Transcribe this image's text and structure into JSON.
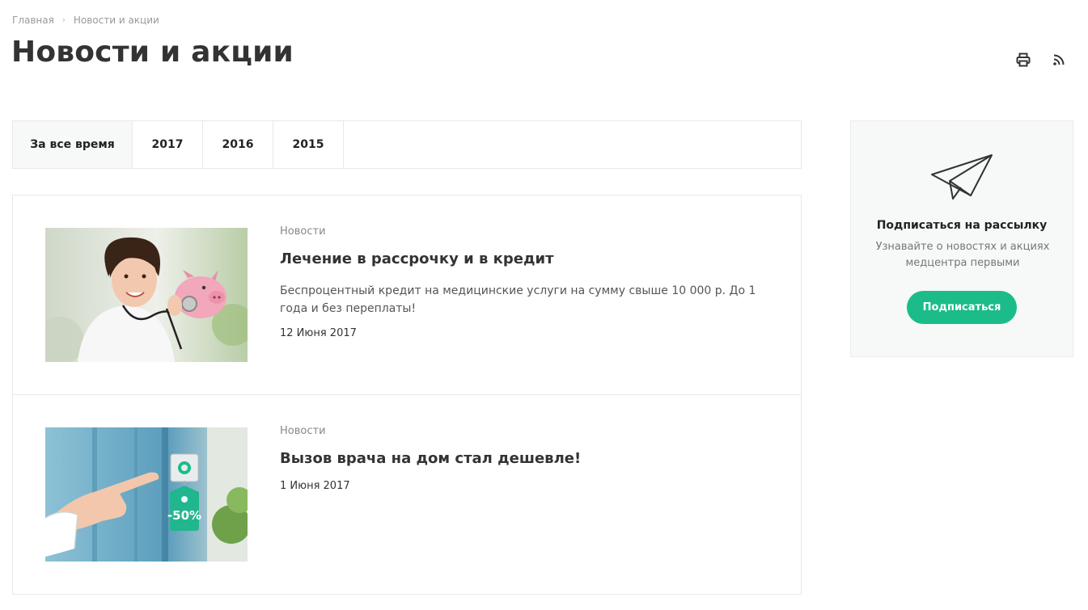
{
  "breadcrumb": {
    "home": "Главная",
    "current": "Новости и акции"
  },
  "page": {
    "title": "Новости и акции"
  },
  "toolbar": {
    "print_icon": "print-icon",
    "rss_icon": "rss-icon"
  },
  "filters": {
    "tabs": [
      {
        "label": "За все время",
        "active": true
      },
      {
        "label": "2017",
        "active": false
      },
      {
        "label": "2016",
        "active": false
      },
      {
        "label": "2015",
        "active": false
      }
    ]
  },
  "news": [
    {
      "category": "Новости",
      "title": "Лечение в рассрочку и в кредит",
      "description": "Беспроцентный кредит на медицинские услуги на сумму свыше 10 000 р. До 1 года и без переплаты!",
      "date": "12 Июня 2017"
    },
    {
      "category": "Новости",
      "title": "Вызов врача на дом стал дешевле!",
      "date": "1 Июня 2017",
      "badge": "-50%"
    }
  ],
  "subscribe": {
    "icon": "paper-plane-icon",
    "title": "Подписаться на рассылку",
    "description": "Узнавайте о новостях и акциях медцентра первыми",
    "button": "Подписаться"
  },
  "colors": {
    "accent": "#1bbc8a",
    "panel": "#f7f8f8",
    "border": "#e8e8e8"
  }
}
